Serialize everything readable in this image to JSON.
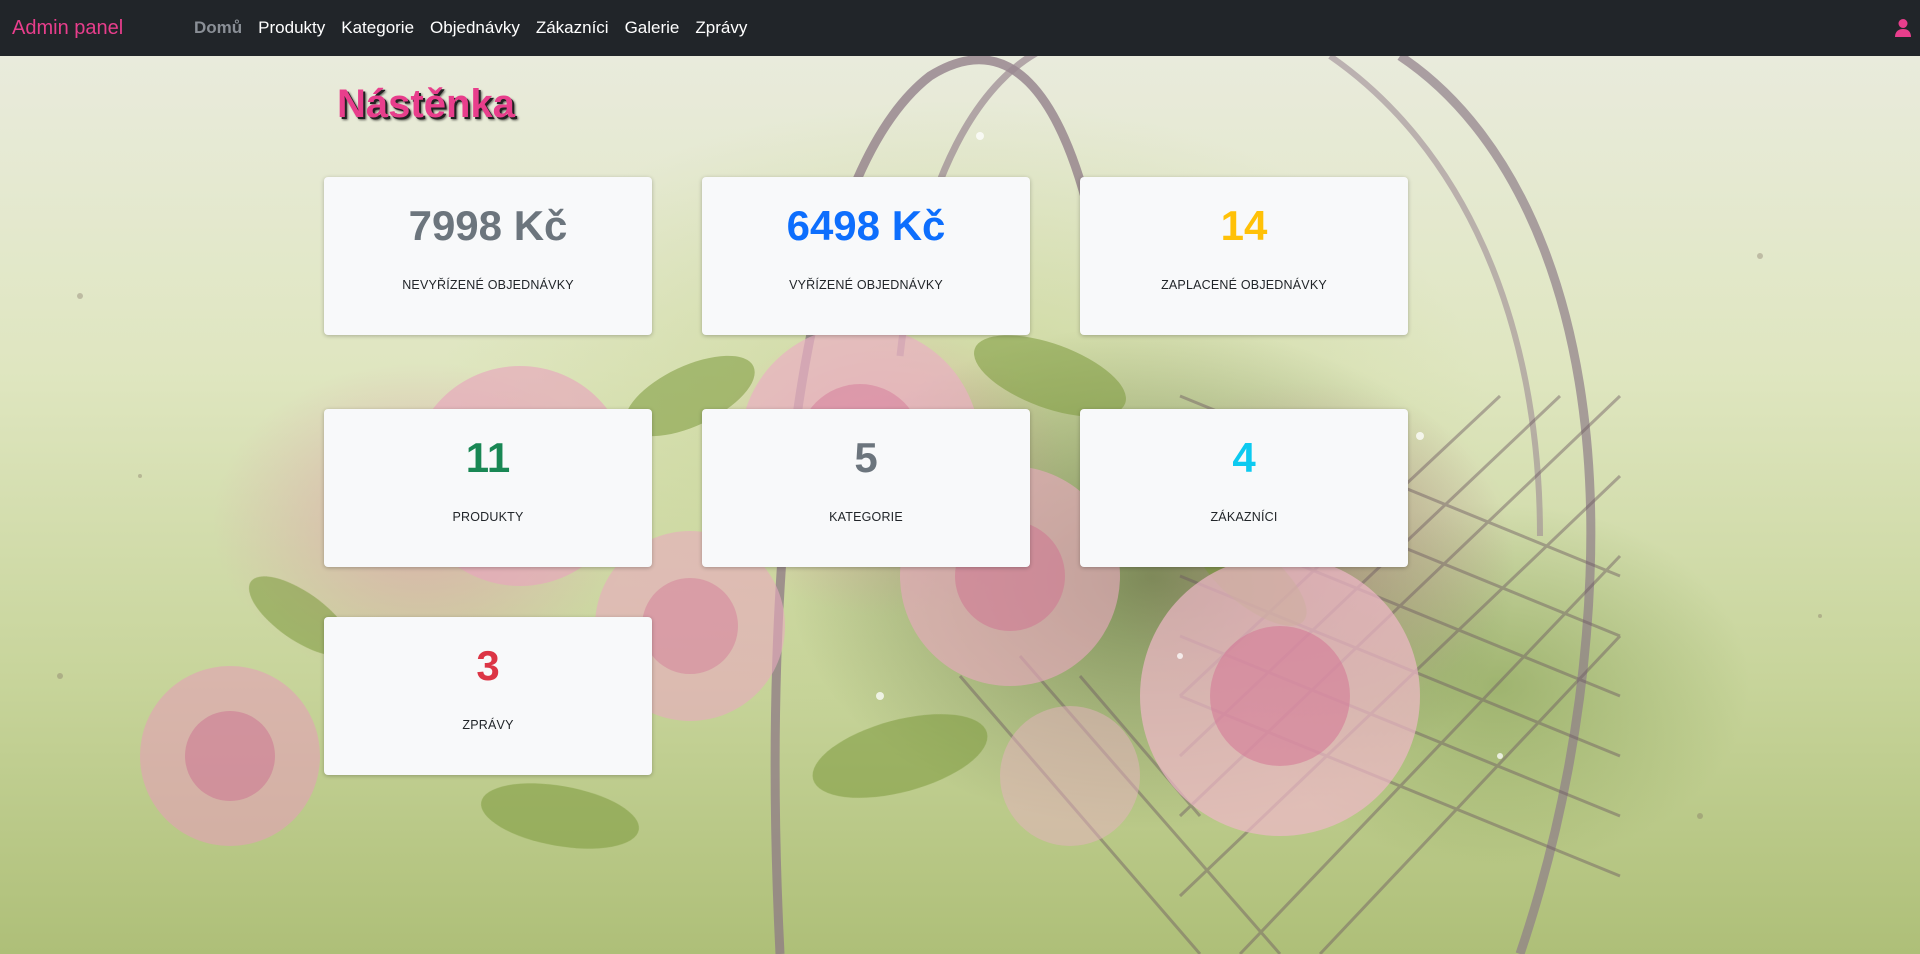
{
  "navbar": {
    "brand": "Admin panel",
    "links": [
      "Domů",
      "Produkty",
      "Kategorie",
      "Objednávky",
      "Zákazníci",
      "Galerie",
      "Zprávy"
    ],
    "active_index": 0,
    "user_icon": "user-icon"
  },
  "page": {
    "title": "Nástěnka"
  },
  "cards": [
    {
      "value": "7998 Kč",
      "label": "NEVYŘÍZENÉ OBJEDNÁVKY",
      "color": "#6c757d"
    },
    {
      "value": "6498 Kč",
      "label": "VYŘÍZENÉ OBJEDNÁVKY",
      "color": "#0d6efd"
    },
    {
      "value": "14",
      "label": "ZAPLACENÉ OBJEDNÁVKY",
      "color": "#ffc107"
    },
    {
      "value": "11",
      "label": "PRODUKTY",
      "color": "#198754"
    },
    {
      "value": "5",
      "label": "KATEGORIE",
      "color": "#6c757d"
    },
    {
      "value": "4",
      "label": "ZÁKAZNÍCI",
      "color": "#0dcaf0"
    },
    {
      "value": "3",
      "label": "ZPRÁVY",
      "color": "#dc3545"
    }
  ],
  "colors": {
    "navbar_bg": "#212529",
    "brand": "#e83e8c",
    "title": "#e83e8c",
    "card_bg": "#f8f9fa"
  }
}
